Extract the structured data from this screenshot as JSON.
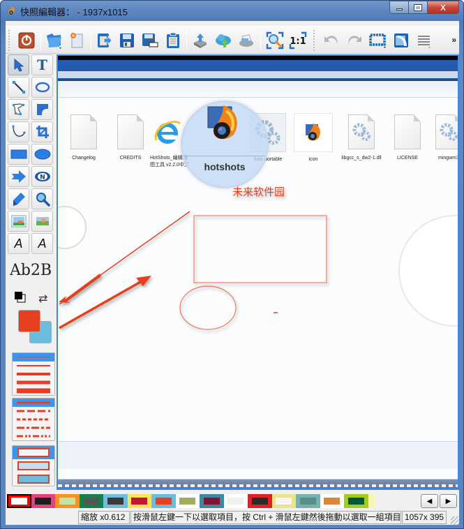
{
  "window": {
    "title": "快照編輯器： - 1937x1015",
    "minimize_label": "—",
    "maximize_label": "□",
    "close_label": "X"
  },
  "toolbar": {
    "items": [
      {
        "name": "exit",
        "icon": "power-icon"
      },
      {
        "name": "open",
        "icon": "folder-icon",
        "has_dropdown": true
      },
      {
        "name": "new",
        "icon": "new-document-icon"
      },
      {
        "name": "export",
        "icon": "export-clipboard-icon"
      },
      {
        "name": "save",
        "icon": "save-icon"
      },
      {
        "name": "save-as",
        "icon": "save-as-icon"
      },
      {
        "name": "copy-to-clipboard",
        "icon": "clipboard-icon"
      },
      {
        "name": "upload",
        "icon": "upload-tray-icon"
      },
      {
        "name": "cloud-upload",
        "icon": "cloud-upload-icon"
      },
      {
        "name": "print",
        "icon": "printer-icon"
      },
      {
        "name": "zoom-fit",
        "icon": "zoom-fit-icon"
      },
      {
        "name": "actual-size",
        "icon": "actual-size-icon",
        "label": "1:1"
      },
      {
        "name": "undo",
        "icon": "undo-icon"
      },
      {
        "name": "redo",
        "icon": "redo-icon"
      },
      {
        "name": "canvas-size",
        "icon": "canvas-border-icon",
        "has_dropdown": true
      },
      {
        "name": "send",
        "icon": "send-icon"
      },
      {
        "name": "menu",
        "icon": "hamburger-icon",
        "has_dropdown": true
      }
    ],
    "overflow_label": "»"
  },
  "toolbox": {
    "tools": [
      {
        "name": "select",
        "icon": "pointer-icon",
        "active": true
      },
      {
        "name": "text",
        "icon": "text-icon",
        "label": "T"
      },
      {
        "name": "line",
        "icon": "line-icon"
      },
      {
        "name": "freehand-ellipse",
        "icon": "lasso-icon"
      },
      {
        "name": "polygon",
        "icon": "polygon-icon"
      },
      {
        "name": "rounded-corner",
        "icon": "rounded-corner-icon"
      },
      {
        "name": "curve",
        "icon": "curve-icon"
      },
      {
        "name": "crop",
        "icon": "crop-icon"
      },
      {
        "name": "rectangle",
        "icon": "rectangle-icon"
      },
      {
        "name": "ellipse",
        "icon": "ellipse-icon"
      },
      {
        "name": "arrow",
        "icon": "arrow-icon"
      },
      {
        "name": "number-stamp",
        "icon": "number-badge-icon",
        "label": "N"
      },
      {
        "name": "highlighter",
        "icon": "highlighter-icon"
      },
      {
        "name": "magnify",
        "icon": "magnifier-icon"
      },
      {
        "name": "insert-image",
        "icon": "image-icon"
      },
      {
        "name": "blur-image",
        "icon": "image-blur-icon"
      },
      {
        "name": "font-increase",
        "icon": "font-up-icon",
        "label": "A"
      },
      {
        "name": "font-decrease",
        "icon": "font-down-icon",
        "label": "A"
      }
    ],
    "font_preview": "Ab2B",
    "foreground_color": "#e5401f",
    "background_color": "#6bbde0"
  },
  "canvas": {
    "files": [
      {
        "label": "Changelog",
        "type": "document"
      },
      {
        "label": "CREDITS",
        "type": "document"
      },
      {
        "label": "HotShots_编辑截图工具 v2.2.0中文绿色版_带图片编...",
        "type": "ie"
      },
      {
        "label": "hots-portable",
        "type": "gear"
      },
      {
        "label": "icon",
        "type": "hotshots"
      },
      {
        "label": "libgcc_s_dw2-1.dll",
        "type": "gear-doc"
      },
      {
        "label": "LICENSE",
        "type": "document"
      },
      {
        "label": "mingwm1",
        "type": "gear-doc"
      }
    ],
    "magnifier_label": "hotshots",
    "annotation_text": "未来软件园",
    "annotation_color": "#e5401f"
  },
  "palette": {
    "swatches": [
      {
        "outer": "#ff0000",
        "inner": "#ffffff",
        "selected": true
      },
      {
        "outer": "#e4417e",
        "inner": "#1e1e1e"
      },
      {
        "outer": "#f7931e",
        "inner": "#c5e3a6"
      },
      {
        "outer": "#148148",
        "inner": "#555555"
      },
      {
        "outer": "#6fbfdc",
        "inner": "#3a3a3a"
      },
      {
        "outer": "#fde25a",
        "inner": "#c2182c"
      },
      {
        "outer": "#6bbde0",
        "inner": "#e5401f"
      },
      {
        "outer": "#ffffff",
        "inner": "#a3ac5c"
      },
      {
        "outer": "#3d8aa0",
        "inner": "#7e1735"
      },
      {
        "outer": "#ffffff",
        "inner": "#f0efea"
      },
      {
        "outer": "#e31e24",
        "inner": "#2a2a2a"
      },
      {
        "outer": "#ebe387",
        "inner": "#f6f6f6"
      },
      {
        "outer": "#78b0ae",
        "inner": "#588f88"
      },
      {
        "outer": "#ffffff",
        "inner": "#dc873e"
      },
      {
        "outer": "#a5cc1a",
        "inner": "#00573a"
      },
      {
        "outer": "#f7f6b0",
        "inner": "#f7f6b0"
      }
    ],
    "prev_label": "◀",
    "next_label": "▶"
  },
  "status": {
    "zoom": "縮放  x0.612",
    "hint": "按滑鼠左鍵一下以選取項目，按 Ctrl + 滑鼠左鍵然後拖動以選取一組項目",
    "size": "1057x 395"
  }
}
